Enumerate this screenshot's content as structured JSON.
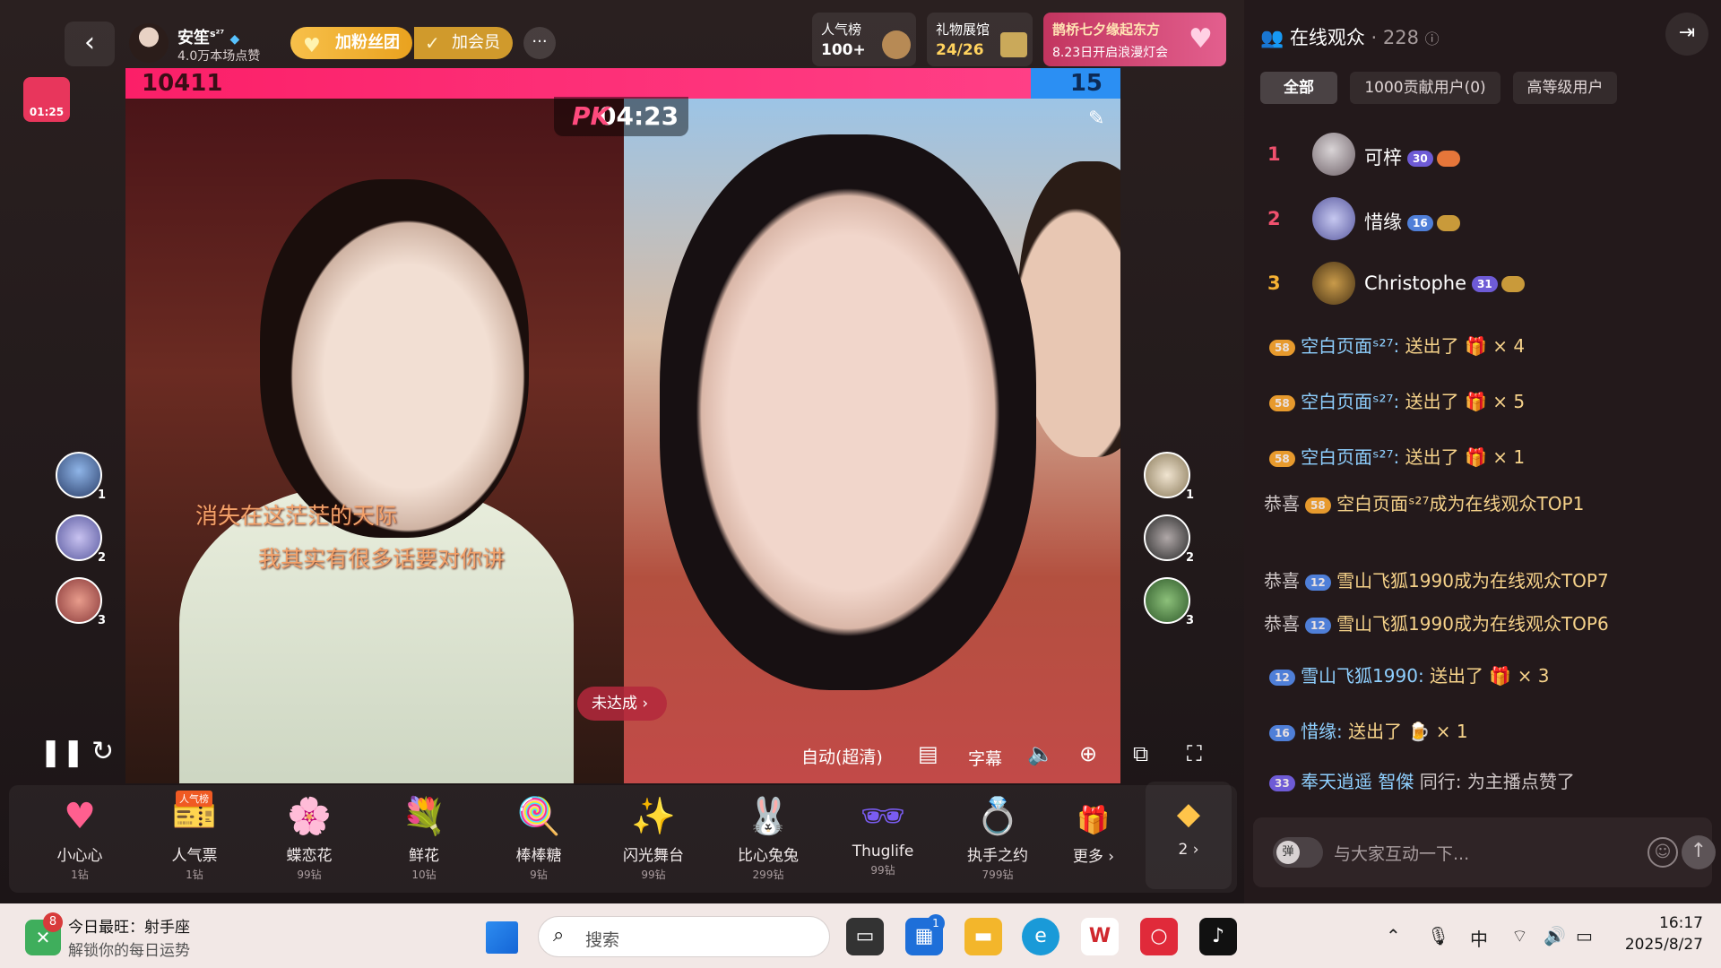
{
  "stage": {
    "back_icon": "chevron-left-icon",
    "anchor": {
      "name": "安笙",
      "superscript": "s²⁷",
      "likes": "4.0万本场点赞"
    },
    "fan_button": "加粉丝团",
    "vip_button": "加会员",
    "more_icon": "···",
    "popularity": {
      "title": "人气榜",
      "value": "100+"
    },
    "gift_hall": {
      "title": "礼物展馆",
      "value": "24/26"
    },
    "promo": {
      "title": "鹊桥七夕缘起东方",
      "sub": "8.23日开启浪漫灯会"
    },
    "timer_badge": "01:25",
    "pk": {
      "left_score": "10411",
      "right_score": "15",
      "label": "PK",
      "time": "04:23",
      "left_fraction": 0.91
    },
    "lyrics": [
      "消失在这茫茫的天际",
      "我其实有很多话要对你讲"
    ],
    "not_done": "未达成 ›",
    "left_ranks": [
      "1",
      "2",
      "3"
    ],
    "right_ranks": [
      "1",
      "2",
      "3"
    ],
    "controls": {
      "quality": "自动(超清)",
      "subtitle_label": "字幕"
    },
    "gifts": [
      {
        "name": "小心心",
        "price": "1钻",
        "icon": "♥",
        "color": "#ff5f8f"
      },
      {
        "name": "人气票",
        "price": "1钻",
        "icon": "🎫",
        "color": "#f0c2d0",
        "tag": "人气榜"
      },
      {
        "name": "蝶恋花",
        "price": "99钻",
        "icon": "🌸",
        "color": "#f2a3c0"
      },
      {
        "name": "鲜花",
        "price": "10钻",
        "icon": "💐",
        "color": "#e23a4a"
      },
      {
        "name": "棒棒糖",
        "price": "9钻",
        "icon": "🍭",
        "color": "#f58ab9"
      },
      {
        "name": "闪光舞台",
        "price": "99钻",
        "icon": "✨",
        "color": "#c9a5f2"
      },
      {
        "name": "比心兔兔",
        "price": "299钻",
        "icon": "🐰",
        "color": "#bcd3ff"
      },
      {
        "name": "Thuglife",
        "price": "99钻",
        "icon": "🕶",
        "color": "#7a5cf2"
      },
      {
        "name": "执手之约",
        "price": "799钻",
        "icon": "💍",
        "color": "#e5a26a"
      }
    ],
    "gifts_more": "更多 ›",
    "gift_pack": "2 ›"
  },
  "panel": {
    "title": "在线观众",
    "count": "228",
    "tabs": [
      "全部",
      "1000贡献用户(0)",
      "高等级用户"
    ],
    "top_users": [
      {
        "rank": "1",
        "name": "可梓",
        "level": "30"
      },
      {
        "rank": "2",
        "name": "惜缘",
        "level": "16"
      },
      {
        "rank": "3",
        "name": "Christophe",
        "level": "31"
      }
    ],
    "messages": [
      {
        "lvl": "58",
        "user": "空白页面ˢ²⁷:",
        "text": "送出了",
        "mult": "× 4"
      },
      {
        "lvl": "58",
        "user": "空白页面ˢ²⁷:",
        "text": "送出了",
        "mult": "× 5"
      },
      {
        "lvl": "58",
        "user": "空白页面ˢ²⁷:",
        "text": "送出了",
        "mult": "× 1"
      },
      {
        "lvl": "58",
        "prefix": "恭喜",
        "text": "空白页面ˢ²⁷成为在线观众TOP1"
      },
      {
        "lvl": "12",
        "prefix": "恭喜",
        "text": "雪山飞狐1990成为在线观众TOP7"
      },
      {
        "lvl": "12",
        "prefix": "恭喜",
        "text": "雪山飞狐1990成为在线观众TOP6"
      },
      {
        "lvl": "12",
        "user": "雪山飞狐1990:",
        "text": "送出了",
        "mult": "× 3"
      },
      {
        "lvl": "16",
        "user": "惜缘:",
        "text": "送出了",
        "mult": "× 1"
      },
      {
        "lvl": "33",
        "user": "奉天逍遥 智傑",
        "text": "同行: 为主播点赞了"
      }
    ],
    "chat_placeholder": "与大家互动一下...",
    "toggle_label": "弹"
  },
  "taskbar": {
    "weather_title": "今日最旺：射手座",
    "weather_sub": "解锁你的每日运势",
    "weather_badge": "8",
    "search_placeholder": "搜索",
    "store_badge": "1",
    "ime": "中",
    "time": "16:17",
    "date": "2025/8/27"
  }
}
